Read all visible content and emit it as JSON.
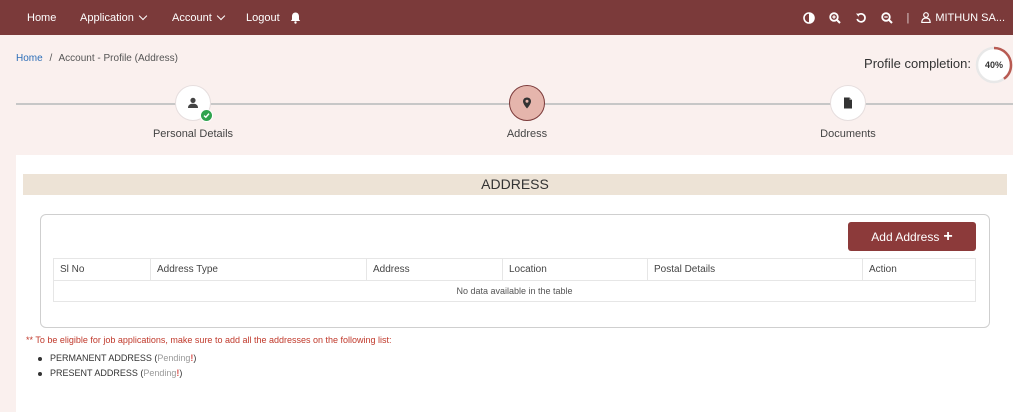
{
  "topnav": {
    "home": "Home",
    "application": "Application",
    "account": "Account",
    "logout": "Logout",
    "separator": "|",
    "user_name": "MITHUN SA..."
  },
  "breadcrumb": {
    "home": "Home",
    "separator": "/",
    "current": "Account - Profile (Address)"
  },
  "profile_completion": {
    "label": "Profile completion:",
    "percent_text": "40%",
    "value": 0.4
  },
  "steps": [
    {
      "label": "Personal Details",
      "icon": "user-icon",
      "completed": true
    },
    {
      "label": "Address",
      "icon": "location-pin-icon",
      "active": true
    },
    {
      "label": "Documents",
      "icon": "document-icon"
    }
  ],
  "section": {
    "title": "ADDRESS",
    "add_button": "Add Address",
    "table": {
      "headers": [
        "Sl No",
        "Address Type",
        "Address",
        "Location",
        "Postal Details",
        "Action"
      ],
      "empty_text": "No data available in the table"
    }
  },
  "note": {
    "text": "** To be eligible for job applications, make sure to add all the addresses on the following list:",
    "items": [
      {
        "name": "PERMANENT ADDRESS",
        "open": " (",
        "status": "Pending",
        "mark": "!",
        "close": ")"
      },
      {
        "name": "PRESENT ADDRESS",
        "open": " (",
        "status": "Pending",
        "mark": "!",
        "close": ")"
      }
    ]
  },
  "colors": {
    "nav_bg": "#7b3a3a",
    "accent": "#8c3a3a",
    "success": "#2fa34e",
    "warning": "#c0392b"
  }
}
